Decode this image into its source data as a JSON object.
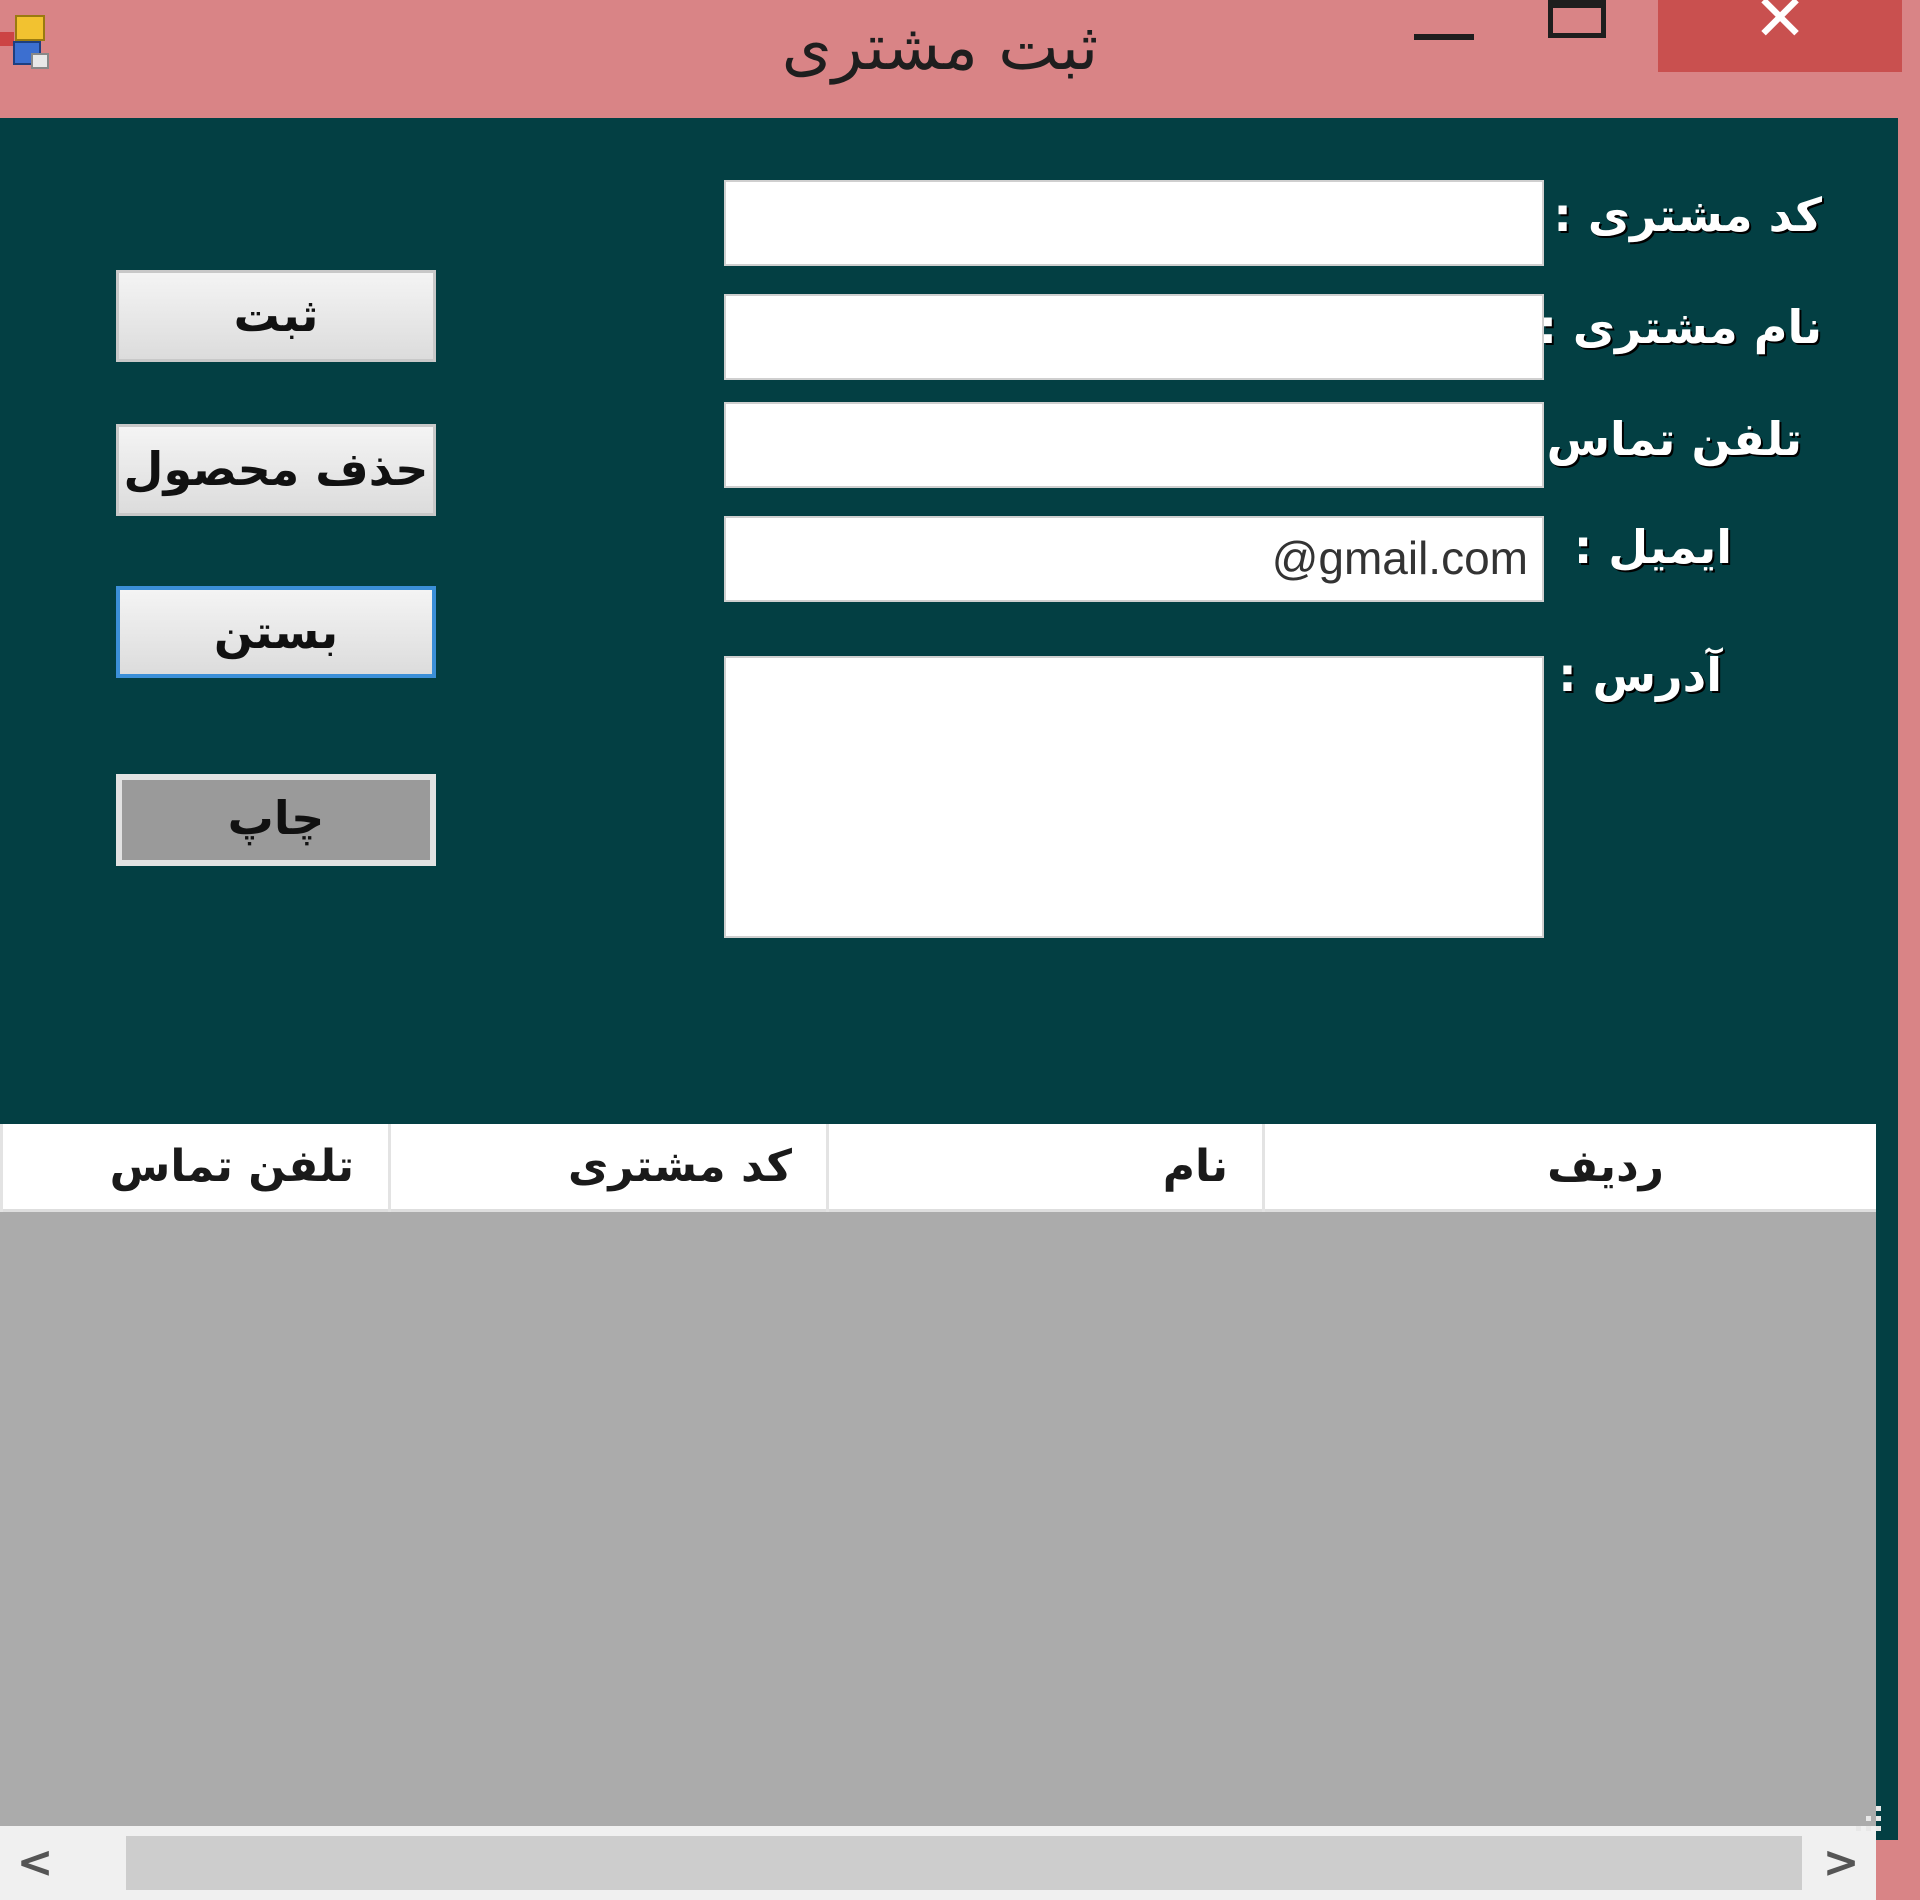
{
  "window": {
    "title": "ثبت مشتری",
    "close_symbol": "✕"
  },
  "form": {
    "labels": {
      "customer_code": "کد مشتری :",
      "customer_name": "نام مشتری :",
      "phone": "تلفن تماس :",
      "email": "ایمیل :",
      "address": "آدرس :"
    },
    "values": {
      "customer_code": "",
      "customer_name": "",
      "phone": "",
      "email": "@gmail.com",
      "address": ""
    }
  },
  "buttons": {
    "register": "ثبت",
    "delete": "حذف محصول",
    "close": "بستن",
    "print": "چاپ"
  },
  "grid": {
    "columns": [
      "ردیف",
      "نام",
      "کد مشتری",
      "تلفن تماس"
    ],
    "rows": [],
    "scroll_left": "<",
    "scroll_right": ">"
  },
  "icons": {
    "app": "app-icon",
    "minimize": "minimize-icon",
    "maximize": "maximize-icon",
    "close": "close-icon",
    "resize_grip": "resize-grip-icon"
  },
  "colors": {
    "titlebar": "#d98486",
    "client_background": "#033f43",
    "close_button": "#c9504f",
    "grid_background": "#ababab"
  }
}
